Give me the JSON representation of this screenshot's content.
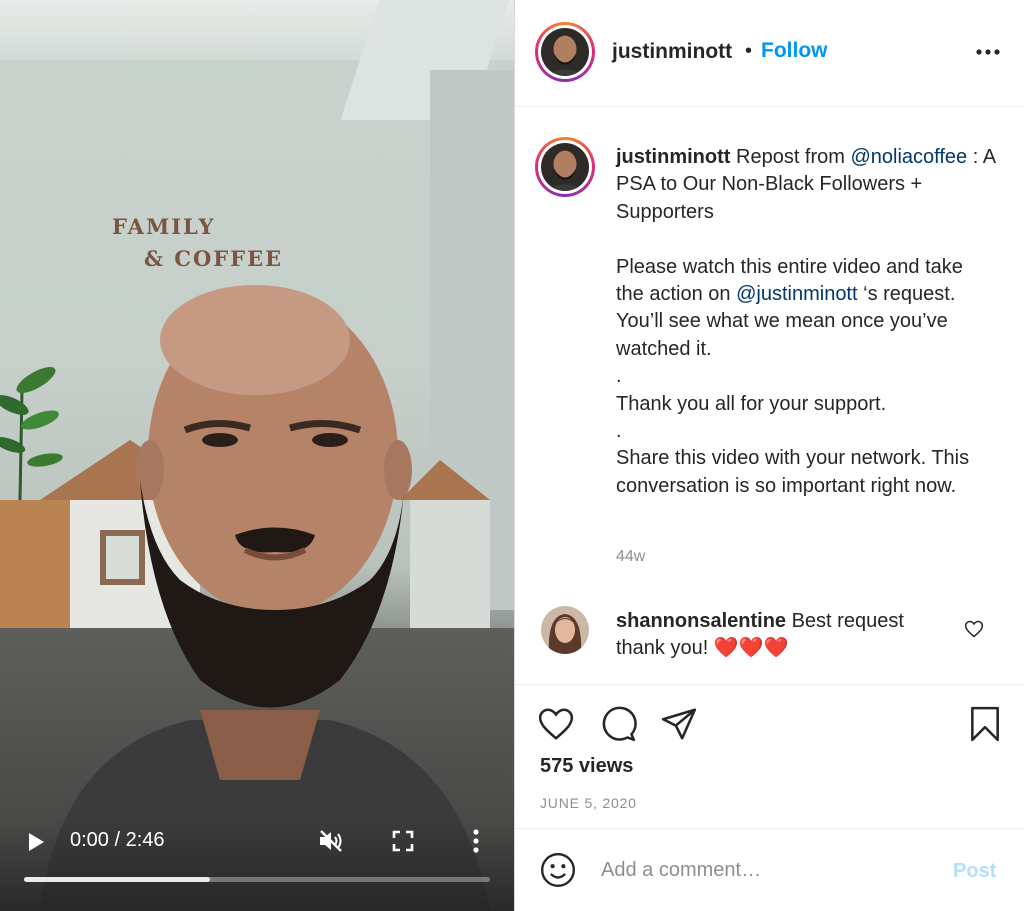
{
  "video": {
    "wall_sign_line1": "FAMILY",
    "wall_sign_line2": "& COFFEE",
    "time": "0:00 / 2:46",
    "progress_fraction": 0.4,
    "controls": {
      "play_icon": "play-icon",
      "mute_icon": "muted-speaker-icon",
      "fullscreen_icon": "fullscreen-icon",
      "more_icon": "vertical-dots-icon"
    }
  },
  "header": {
    "username": "justinminott",
    "separator": "•",
    "follow_label": "Follow",
    "more_icon": "horizontal-dots-icon"
  },
  "caption": {
    "username": "justinminott",
    "line_repost": "Repost from",
    "mention1": "@noliacoffee",
    "line_after_mention": ": A PSA to Our Non-Black Followers + Supporters",
    "para2_a": "Please watch this entire video and take the action on",
    "mention2": "@justinminott",
    "para2_b": "‘s request. You’ll see what we mean once you’ve watched it.",
    "dot1": ".",
    "para3": "Thank you all for your support.",
    "dot2": ".",
    "para4": "Share this video with your network. This conversation is so important right now.",
    "age": "44w"
  },
  "comment": {
    "username": "shannonsalentine",
    "text": "Best request thank you! ❤️❤️❤️",
    "like_icon": "heart-outline-icon"
  },
  "actions": {
    "icons": [
      "heart-icon",
      "comment-icon",
      "share-icon",
      "bookmark-icon"
    ],
    "views": "575 views",
    "date": "JUNE 5, 2020"
  },
  "add_comment": {
    "placeholder": "Add a comment…",
    "post_label": "Post",
    "emoji_icon": "emoji-icon"
  },
  "colors": {
    "accent": "#0095f6",
    "mention": "#00376b",
    "muted_text": "#8e8e8e",
    "post_disabled": "#b2dffc"
  }
}
